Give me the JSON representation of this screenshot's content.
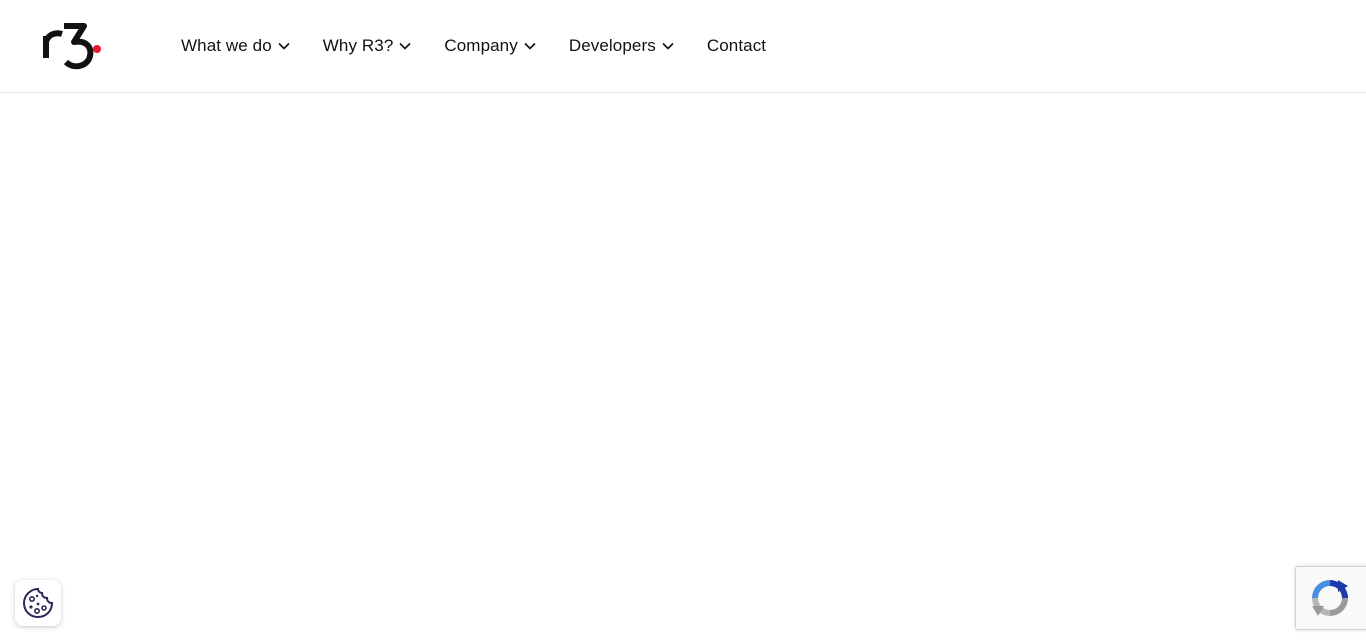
{
  "header": {
    "logo_text": "r3.",
    "brand_accent": "#e4162a"
  },
  "nav": {
    "items": [
      {
        "label": "What we do",
        "has_dropdown": true
      },
      {
        "label": "Why R3?",
        "has_dropdown": true
      },
      {
        "label": "Company",
        "has_dropdown": true
      },
      {
        "label": "Developers",
        "has_dropdown": true
      },
      {
        "label": "Contact",
        "has_dropdown": false
      }
    ]
  },
  "widgets": {
    "cookie_icon": "cookie-icon",
    "recaptcha_icon": "recaptcha-icon"
  }
}
